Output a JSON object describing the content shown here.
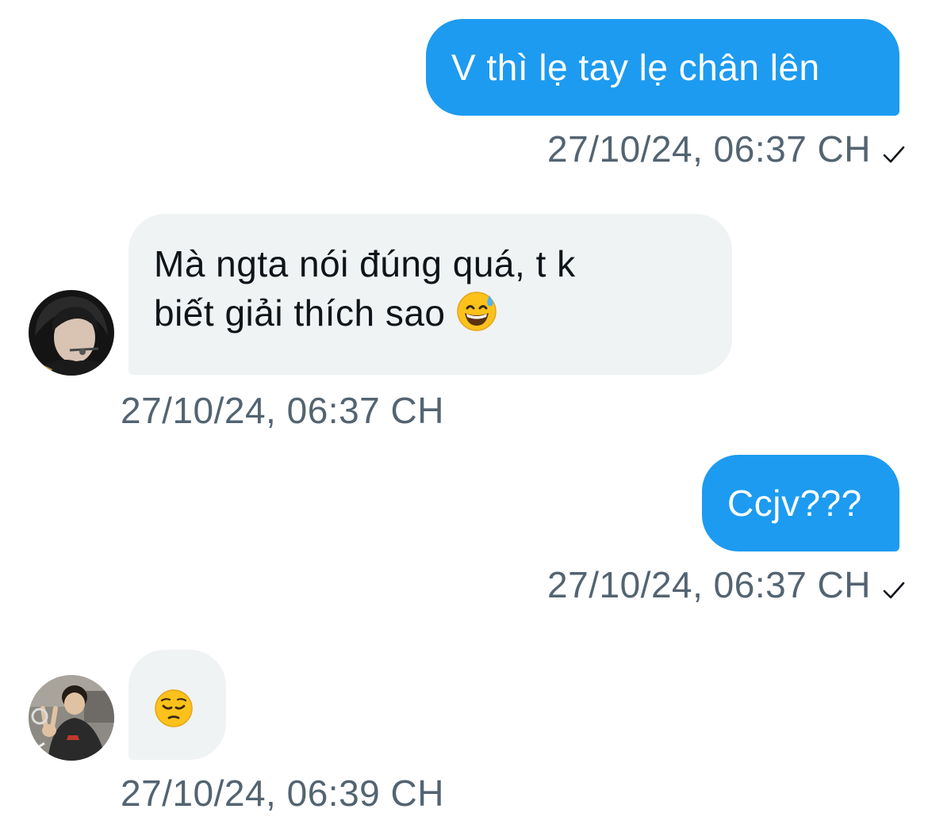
{
  "conversation": {
    "messages": [
      {
        "direction": "sent",
        "text": "V thì lẹ tay lẹ chân lên",
        "timestamp": "27/10/24, 06:37 CH",
        "status_icon": "checkmark-icon"
      },
      {
        "direction": "received",
        "text_line1": "Mà ngta nói đúng quá, t k",
        "text_line2": "biết giải thích sao",
        "emoji": "grinning-face-with-sweat",
        "timestamp": "27/10/24, 06:37 CH",
        "avatar": "avatar-with-headset"
      },
      {
        "direction": "sent",
        "text": "Ccjv???",
        "timestamp": "27/10/24, 06:37 CH",
        "status_icon": "checkmark-icon"
      },
      {
        "direction": "received",
        "emoji": "pensive-face",
        "timestamp": "27/10/24, 06:39 CH",
        "avatar": "avatar-peace-sign"
      }
    ]
  },
  "colors": {
    "sent_bubble": "#1d9bf0",
    "received_bubble": "#eff3f4",
    "timestamp_text": "#536471",
    "received_text": "#0f1419"
  }
}
